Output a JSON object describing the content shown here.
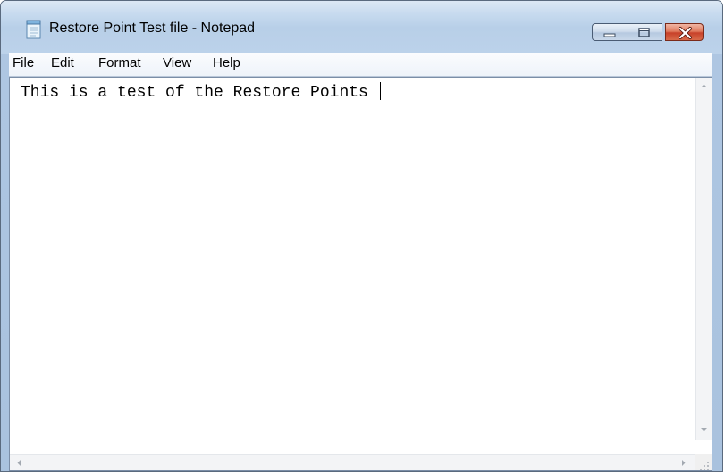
{
  "window": {
    "title": "Restore Point Test file - Notepad"
  },
  "menu": {
    "items": [
      {
        "label": "File"
      },
      {
        "label": "Edit"
      },
      {
        "label": "Format"
      },
      {
        "label": "View"
      },
      {
        "label": "Help"
      }
    ]
  },
  "editor": {
    "content": "This is a test of the Restore Points "
  },
  "icons": {
    "app": "notepad-icon",
    "minimize": "minimize-icon",
    "maximize": "maximize-icon",
    "close": "close-icon"
  },
  "colors": {
    "title_bar": "#c8dbef",
    "close_button": "#c8412a",
    "menu_bar": "#f4f7fc",
    "editor_background": "#ffffff"
  }
}
